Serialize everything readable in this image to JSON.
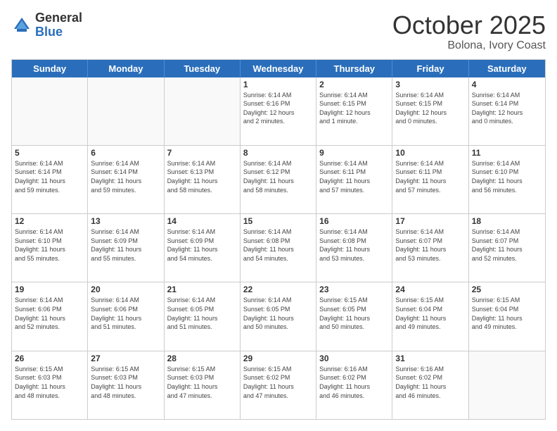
{
  "header": {
    "logo_general": "General",
    "logo_blue": "Blue",
    "title": "October 2025",
    "location": "Bolona, Ivory Coast"
  },
  "days_of_week": [
    "Sunday",
    "Monday",
    "Tuesday",
    "Wednesday",
    "Thursday",
    "Friday",
    "Saturday"
  ],
  "weeks": [
    [
      {
        "day": "",
        "info": ""
      },
      {
        "day": "",
        "info": ""
      },
      {
        "day": "",
        "info": ""
      },
      {
        "day": "1",
        "info": "Sunrise: 6:14 AM\nSunset: 6:16 PM\nDaylight: 12 hours\nand 2 minutes."
      },
      {
        "day": "2",
        "info": "Sunrise: 6:14 AM\nSunset: 6:15 PM\nDaylight: 12 hours\nand 1 minute."
      },
      {
        "day": "3",
        "info": "Sunrise: 6:14 AM\nSunset: 6:15 PM\nDaylight: 12 hours\nand 0 minutes."
      },
      {
        "day": "4",
        "info": "Sunrise: 6:14 AM\nSunset: 6:14 PM\nDaylight: 12 hours\nand 0 minutes."
      }
    ],
    [
      {
        "day": "5",
        "info": "Sunrise: 6:14 AM\nSunset: 6:14 PM\nDaylight: 11 hours\nand 59 minutes."
      },
      {
        "day": "6",
        "info": "Sunrise: 6:14 AM\nSunset: 6:14 PM\nDaylight: 11 hours\nand 59 minutes."
      },
      {
        "day": "7",
        "info": "Sunrise: 6:14 AM\nSunset: 6:13 PM\nDaylight: 11 hours\nand 58 minutes."
      },
      {
        "day": "8",
        "info": "Sunrise: 6:14 AM\nSunset: 6:12 PM\nDaylight: 11 hours\nand 58 minutes."
      },
      {
        "day": "9",
        "info": "Sunrise: 6:14 AM\nSunset: 6:11 PM\nDaylight: 11 hours\nand 57 minutes."
      },
      {
        "day": "10",
        "info": "Sunrise: 6:14 AM\nSunset: 6:11 PM\nDaylight: 11 hours\nand 57 minutes."
      },
      {
        "day": "11",
        "info": "Sunrise: 6:14 AM\nSunset: 6:10 PM\nDaylight: 11 hours\nand 56 minutes."
      }
    ],
    [
      {
        "day": "12",
        "info": "Sunrise: 6:14 AM\nSunset: 6:10 PM\nDaylight: 11 hours\nand 55 minutes."
      },
      {
        "day": "13",
        "info": "Sunrise: 6:14 AM\nSunset: 6:09 PM\nDaylight: 11 hours\nand 55 minutes."
      },
      {
        "day": "14",
        "info": "Sunrise: 6:14 AM\nSunset: 6:09 PM\nDaylight: 11 hours\nand 54 minutes."
      },
      {
        "day": "15",
        "info": "Sunrise: 6:14 AM\nSunset: 6:08 PM\nDaylight: 11 hours\nand 54 minutes."
      },
      {
        "day": "16",
        "info": "Sunrise: 6:14 AM\nSunset: 6:08 PM\nDaylight: 11 hours\nand 53 minutes."
      },
      {
        "day": "17",
        "info": "Sunrise: 6:14 AM\nSunset: 6:07 PM\nDaylight: 11 hours\nand 53 minutes."
      },
      {
        "day": "18",
        "info": "Sunrise: 6:14 AM\nSunset: 6:07 PM\nDaylight: 11 hours\nand 52 minutes."
      }
    ],
    [
      {
        "day": "19",
        "info": "Sunrise: 6:14 AM\nSunset: 6:06 PM\nDaylight: 11 hours\nand 52 minutes."
      },
      {
        "day": "20",
        "info": "Sunrise: 6:14 AM\nSunset: 6:06 PM\nDaylight: 11 hours\nand 51 minutes."
      },
      {
        "day": "21",
        "info": "Sunrise: 6:14 AM\nSunset: 6:05 PM\nDaylight: 11 hours\nand 51 minutes."
      },
      {
        "day": "22",
        "info": "Sunrise: 6:14 AM\nSunset: 6:05 PM\nDaylight: 11 hours\nand 50 minutes."
      },
      {
        "day": "23",
        "info": "Sunrise: 6:15 AM\nSunset: 6:05 PM\nDaylight: 11 hours\nand 50 minutes."
      },
      {
        "day": "24",
        "info": "Sunrise: 6:15 AM\nSunset: 6:04 PM\nDaylight: 11 hours\nand 49 minutes."
      },
      {
        "day": "25",
        "info": "Sunrise: 6:15 AM\nSunset: 6:04 PM\nDaylight: 11 hours\nand 49 minutes."
      }
    ],
    [
      {
        "day": "26",
        "info": "Sunrise: 6:15 AM\nSunset: 6:03 PM\nDaylight: 11 hours\nand 48 minutes."
      },
      {
        "day": "27",
        "info": "Sunrise: 6:15 AM\nSunset: 6:03 PM\nDaylight: 11 hours\nand 48 minutes."
      },
      {
        "day": "28",
        "info": "Sunrise: 6:15 AM\nSunset: 6:03 PM\nDaylight: 11 hours\nand 47 minutes."
      },
      {
        "day": "29",
        "info": "Sunrise: 6:15 AM\nSunset: 6:02 PM\nDaylight: 11 hours\nand 47 minutes."
      },
      {
        "day": "30",
        "info": "Sunrise: 6:16 AM\nSunset: 6:02 PM\nDaylight: 11 hours\nand 46 minutes."
      },
      {
        "day": "31",
        "info": "Sunrise: 6:16 AM\nSunset: 6:02 PM\nDaylight: 11 hours\nand 46 minutes."
      },
      {
        "day": "",
        "info": ""
      }
    ]
  ]
}
